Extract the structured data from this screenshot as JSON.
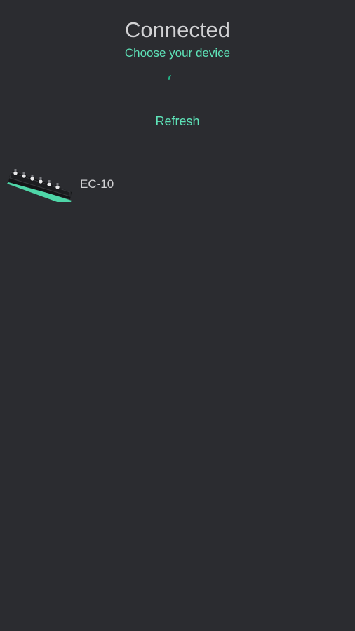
{
  "header": {
    "title": "Connected",
    "subtitle": "Choose your device"
  },
  "actions": {
    "refresh_label": "Refresh"
  },
  "devices": [
    {
      "name": "EC-10",
      "icon": "pedal-board-icon"
    }
  ],
  "colors": {
    "background": "#2b2c30",
    "accent": "#5ee3b8",
    "text": "#d2d2d4",
    "divider": "#8a8b8f"
  }
}
